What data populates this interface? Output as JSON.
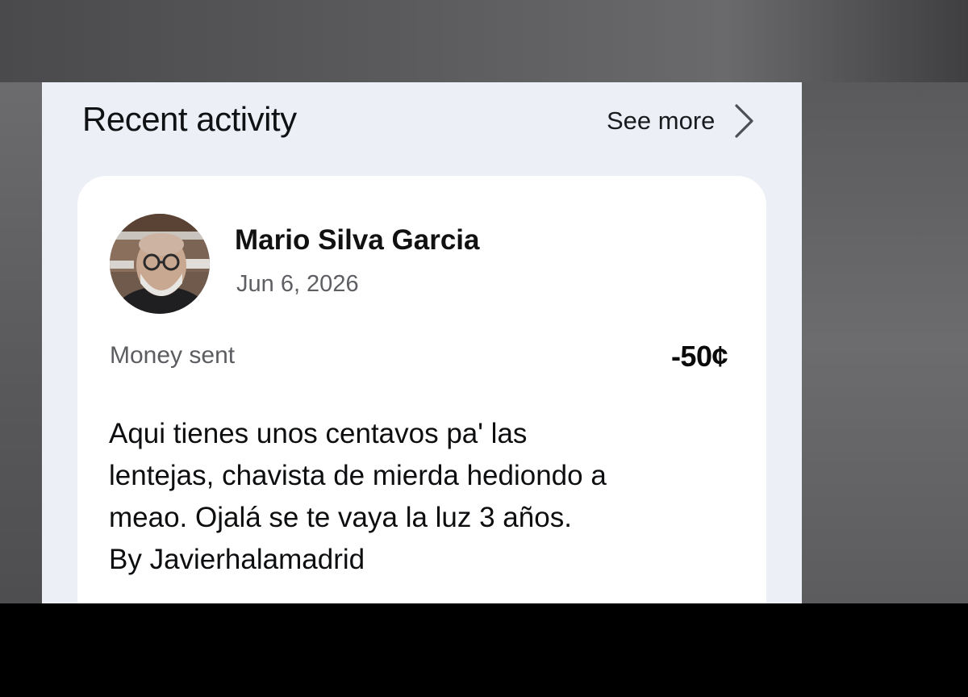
{
  "section": {
    "title": "Recent activity",
    "see_more_label": "See more",
    "chevron_icon": "chevron-right-icon"
  },
  "activity": {
    "avatar_icon": "user-avatar-photo",
    "name": "Mario Silva Garcia",
    "date": "Jun 6, 2026",
    "type": "Money sent",
    "amount": "-50¢",
    "note_lines": [
      "Aqui tienes unos centavos pa' las",
      "lentejas, chavista de mierda hediondo a",
      "meao. Ojalá se te vaya la luz 3 años.",
      "By Javierhalamadrid"
    ]
  }
}
